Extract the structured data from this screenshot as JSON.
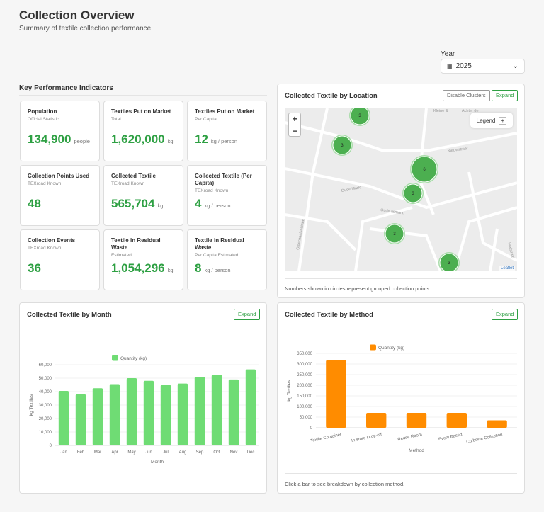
{
  "header": {
    "title": "Collection Overview",
    "subtitle": "Summary of textile collection performance"
  },
  "year": {
    "label": "Year",
    "value": "2025",
    "icon": "calendar-icon"
  },
  "kpi": {
    "heading": "Key Performance Indicators",
    "cards": [
      {
        "title": "Population",
        "subtitle": "Official Statistic",
        "value": "134,900",
        "unit": "people"
      },
      {
        "title": "Textiles Put on Market",
        "subtitle": "Total",
        "value": "1,620,000",
        "unit": "kg"
      },
      {
        "title": "Textiles Put on Market",
        "subtitle": "Per Capita",
        "value": "12",
        "unit": "kg / person"
      },
      {
        "title": "Collection Points Used",
        "subtitle": "TEXroad Known",
        "value": "48",
        "unit": ""
      },
      {
        "title": "Collected Textile",
        "subtitle": "TEXroad Known",
        "value": "565,704",
        "unit": "kg"
      },
      {
        "title": "Collected Textile (Per Capita)",
        "subtitle": "TEXroad Known",
        "value": "4",
        "unit": "kg / person"
      },
      {
        "title": "Collection Events",
        "subtitle": "TEXroad Known",
        "value": "36",
        "unit": ""
      },
      {
        "title": "Textile in Residual Waste",
        "subtitle": "Estimated",
        "value": "1,054,296",
        "unit": "kg"
      },
      {
        "title": "Textile in Residual Waste",
        "subtitle": "Per Capita Estimated",
        "value": "8",
        "unit": "kg / person"
      }
    ]
  },
  "map": {
    "title": "Collected Textile by Location",
    "disable_clusters": "Disable Clusters",
    "expand": "Expand",
    "legend": "Legend",
    "zoom_in": "+",
    "zoom_out": "−",
    "attribution": "Leaflet",
    "note": "Numbers shown in circles represent grouped collection points.",
    "clusters": [
      "3",
      "3",
      "6",
      "3",
      "3",
      "3"
    ],
    "streets": [
      "Nieuwstraat",
      "Oude Markt",
      "Oude Ijsmarkt",
      "Oldenzaalsestraat",
      "Walstraat",
      "Kleine &",
      "Achter de"
    ]
  },
  "month_panel": {
    "title": "Collected Textile by Month",
    "expand": "Expand"
  },
  "method_panel": {
    "title": "Collected Textile by Method",
    "expand": "Expand",
    "note": "Click a bar to see breakdown by collection method."
  },
  "chart_data": [
    {
      "type": "bar",
      "xlabel": "Month",
      "ylabel": "kg Textiles",
      "legend": "Quantity (kg)",
      "legend_placement": "top",
      "color": "#6fdc74",
      "ylim": [
        0,
        60000
      ],
      "yticks": [
        "0",
        "10,000",
        "20,000",
        "30,000",
        "40,000",
        "50,000",
        "60,000"
      ],
      "categories": [
        "Jan",
        "Feb",
        "Mar",
        "Apr",
        "May",
        "Jun",
        "Jul",
        "Aug",
        "Sep",
        "Oct",
        "Nov",
        "Dec"
      ],
      "values": [
        40500,
        38000,
        42500,
        45500,
        50000,
        48000,
        45000,
        46000,
        51000,
        52500,
        49000,
        56500
      ]
    },
    {
      "type": "bar",
      "xlabel": "Method",
      "ylabel": "kg Textiles",
      "legend": "Quantity (kg)",
      "legend_placement": "top",
      "color": "#ff8c00",
      "ylim": [
        0,
        350000
      ],
      "yticks": [
        "0",
        "50,000",
        "100,000",
        "150,000",
        "200,000",
        "250,000",
        "300,000",
        "350,000"
      ],
      "categories": [
        "Textile Container",
        "In-store Drop-off",
        "Reuse Room",
        "Event Based",
        "Curbside Collection"
      ],
      "values": [
        318000,
        70000,
        70000,
        70000,
        35000
      ]
    }
  ]
}
